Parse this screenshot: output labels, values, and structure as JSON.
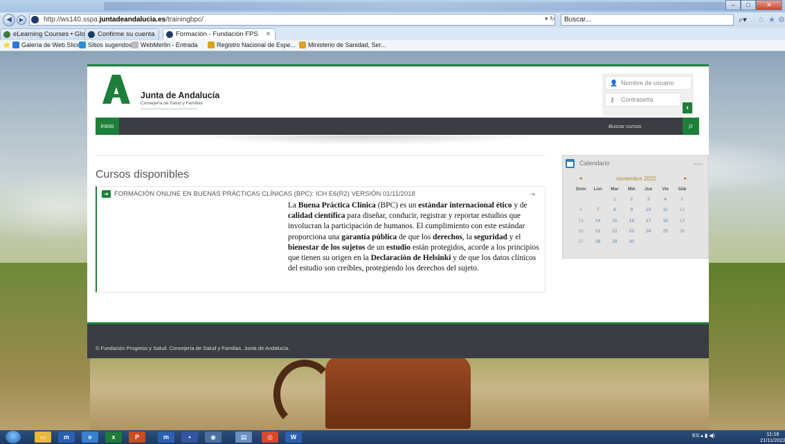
{
  "browser": {
    "url_prefix": "http://ws140.sspa.",
    "url_host": "juntadeandalucia.es",
    "url_path": "/trainingbpc/",
    "refresh_icon": "refresh-icon",
    "search_placeholder": "Buscar...",
    "tabs": [
      {
        "label": "eLearning Courses • Global He..."
      },
      {
        "label": "Confirme su cuenta"
      },
      {
        "label": "Formación - Fundación FPS"
      }
    ],
    "favorites": [
      {
        "label": "Galería de Web Slice ▾"
      },
      {
        "label": "Sitios sugeridos ▾"
      },
      {
        "label": "WebMerlin - Entrada"
      },
      {
        "label": "Registro Nacional de Espe..."
      },
      {
        "label": "Ministerio de Sanidad, Ser..."
      }
    ]
  },
  "header": {
    "brand_title": "Junta de Andalucía",
    "brand_subtitle": "Consejería de Salud y Familias",
    "brand_color": "#1e7f3a",
    "login": {
      "username_placeholder": "Nombre de usuario",
      "password_placeholder": "Contraseña",
      "submit_icon": "chevron-right-icon"
    }
  },
  "nav": {
    "home_label": "Inicio",
    "search_placeholder": "Buscar cursos",
    "search_icon": "search-icon"
  },
  "main": {
    "section_title": "Cursos disponibles",
    "course": {
      "title": "FORMACIÓN ONLINE EN BUENAS PRÁCTICAS CLÍNICAS (BPC): ICH E6(R2) VERSIÓN 01/11/2018",
      "summary_parts": [
        {
          "t": "La ",
          "b": false
        },
        {
          "t": "Buena Práctica Clínica",
          "b": true
        },
        {
          "t": " (BPC) es un ",
          "b": false
        },
        {
          "t": "estándar internacional ético",
          "b": true
        },
        {
          "t": " y de ",
          "b": false
        },
        {
          "t": "calidad científica",
          "b": true
        },
        {
          "t": " para diseñar, conducir, registrar y reportar estudios que involucran la participación de humanos. El cumplimiento con este estándar proporciona una ",
          "b": false
        },
        {
          "t": "garantía pública",
          "b": true
        },
        {
          "t": " de que los ",
          "b": false
        },
        {
          "t": "derechos",
          "b": true
        },
        {
          "t": ", la ",
          "b": false
        },
        {
          "t": "seguridad",
          "b": true
        },
        {
          "t": " y el ",
          "b": false
        },
        {
          "t": "bienestar de los sujetos",
          "b": true
        },
        {
          "t": " de un ",
          "b": false
        },
        {
          "t": "estudio",
          "b": true
        },
        {
          "t": " están protegidos, acorde a los principios que tienen su origen en la ",
          "b": false
        },
        {
          "t": "Declaración de Helsinki",
          "b": true
        },
        {
          "t": " y de que los datos clínicos del estudio son creíbles, protegiendo los derechos del sujeto.",
          "b": false
        }
      ]
    }
  },
  "calendar": {
    "title": "Calendario",
    "month": "noviembre 2022",
    "prev": "◄",
    "next": "►",
    "days_header": [
      "Dom",
      "Lun",
      "Mar",
      "Mié",
      "Jue",
      "Vie",
      "Sáb"
    ],
    "weeks": [
      [
        "",
        "",
        "1",
        "2",
        "3",
        "4",
        "5"
      ],
      [
        "6",
        "7",
        "8",
        "9",
        "10",
        "11",
        "12"
      ],
      [
        "13",
        "14",
        "15",
        "16",
        "17",
        "18",
        "19"
      ],
      [
        "20",
        "21",
        "22",
        "23",
        "24",
        "25",
        "26"
      ],
      [
        "27",
        "28",
        "29",
        "30",
        "",
        "",
        ""
      ]
    ]
  },
  "footer": {
    "text": "© Fundación Progreso y Salud. Consejería de Salud y Familias. Junta de Andalucía."
  },
  "taskbar": {
    "language": "ES",
    "time": "11:16",
    "date": "21/11/2022"
  }
}
